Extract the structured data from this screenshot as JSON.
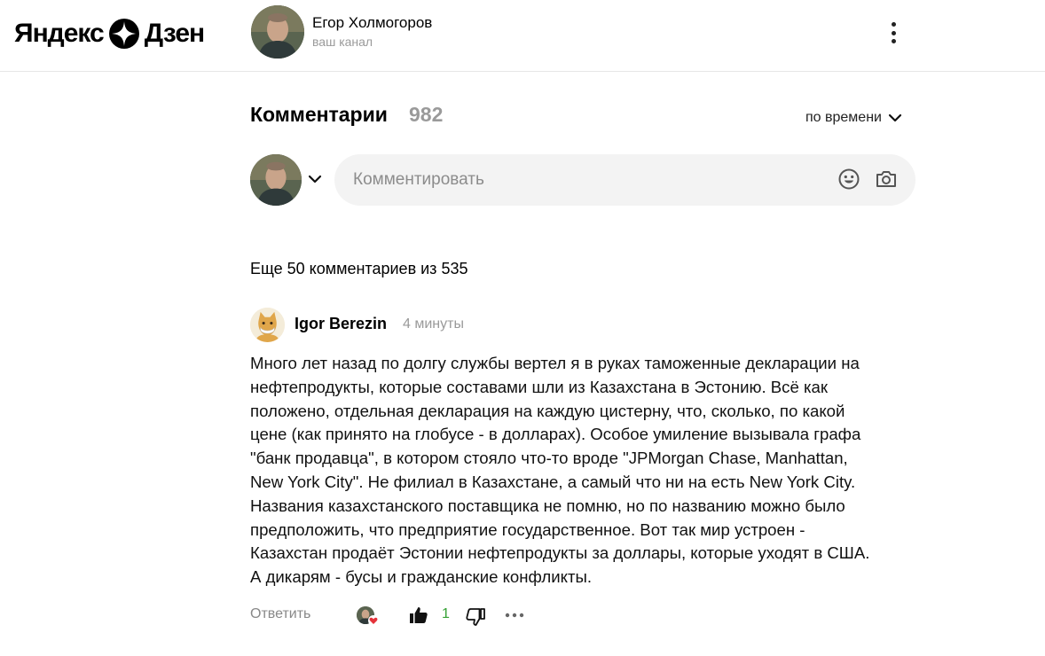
{
  "header": {
    "logo_left": "Яндекс",
    "logo_right": "Дзен",
    "channel_name": "Егор Холмогоров",
    "channel_sub": "ваш канал"
  },
  "comments": {
    "title": "Комментарии",
    "count": "982",
    "sort_label": "по времени",
    "input_placeholder": "Комментировать",
    "more_label": "Еще 50 комментариев из 535"
  },
  "comment": {
    "author": "Igor Berezin",
    "time": "4 минуты",
    "text": "Много лет назад по долгу службы вертел я в руках таможенные декларации на\nнефтепродукты, которые составами шли из Казахстана в Эстонию. Всё как\nположено, отдельная декларация на каждую цистерну, что, сколько, по какой\nцене (как принято на глобусе - в долларах). Особое умиление вызывала графа\n\"банк продавца\", в котором стояло что-то вроде \"JPMorgan Chase, Manhattan,\nNew York City\". Не филиал в Казахстане, а самый что ни на есть New York City.\nНазвания казахстанского поставщика не помню, но по названию можно было\nпредположить, что предприятие государственное. Вот так мир устроен -\nКазахстан продаёт Эстонии нефтепродукты за доллары, которые уходят в США.\nА дикарям - бусы и гражданские конфликты.",
    "reply_label": "Ответить",
    "like_count": "1"
  },
  "colors": {
    "like_green": "#34a133",
    "muted": "#9a9a9a",
    "input_bg": "#f3f3f3"
  },
  "icons": [
    "zen-logo-icon",
    "kebab-menu-icon",
    "chevron-down-icon",
    "smile-icon",
    "camera-icon",
    "thumb-up-icon",
    "thumb-down-icon",
    "more-dots-icon",
    "heart-icon"
  ]
}
